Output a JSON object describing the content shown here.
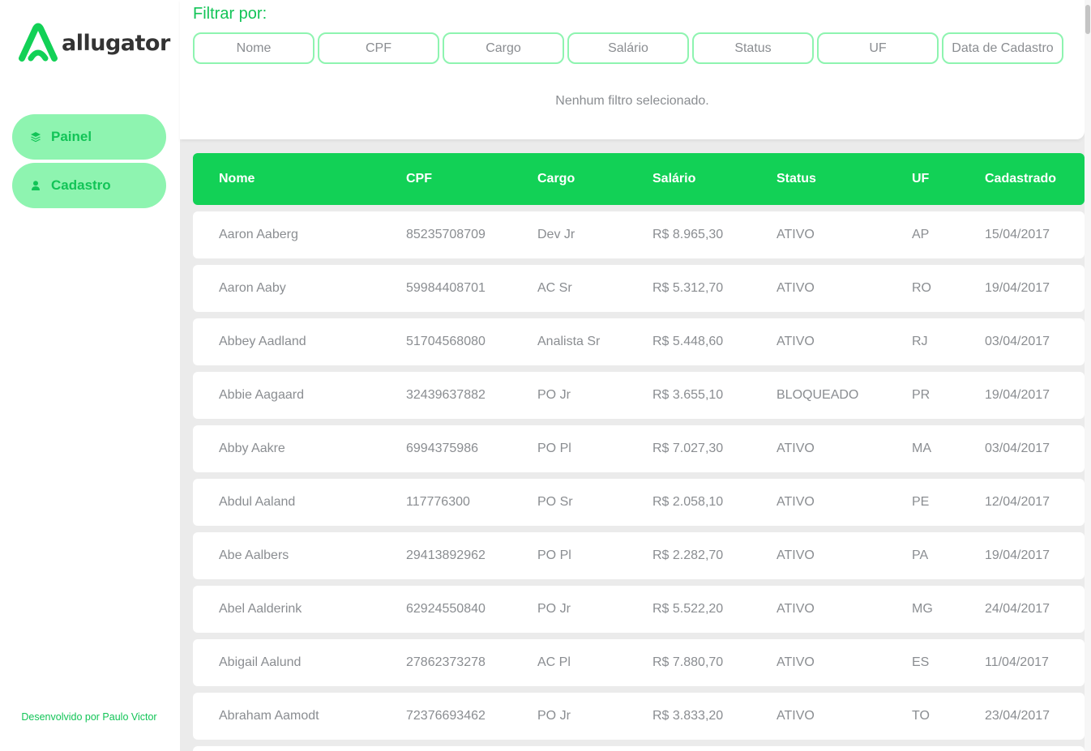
{
  "app": {
    "logo_text": "allugator",
    "brand_color": "#12d156",
    "accent_light": "#8ef4b0",
    "logo_icon": "allugator-a-logo-icon"
  },
  "sidebar": {
    "items": [
      {
        "label": "Painel",
        "icon": "layers-icon"
      },
      {
        "label": "Cadastro",
        "icon": "user-icon"
      }
    ],
    "credit": "Desenvolvido por Paulo Victor"
  },
  "filters": {
    "title": "Filtrar por:",
    "chips": [
      "Nome",
      "CPF",
      "Cargo",
      "Salário",
      "Status",
      "UF",
      "Data de Cadastro"
    ],
    "empty_message": "Nenhum filtro selecionado."
  },
  "table": {
    "columns": [
      "Nome",
      "CPF",
      "Cargo",
      "Salário",
      "Status",
      "UF",
      "Cadastrado"
    ],
    "rows": [
      [
        "Aaron Aaberg",
        "85235708709",
        "Dev Jr",
        "R$ 8.965,30",
        "ATIVO",
        "AP",
        "15/04/2017"
      ],
      [
        "Aaron Aaby",
        "59984408701",
        "AC Sr",
        "R$ 5.312,70",
        "ATIVO",
        "RO",
        "19/04/2017"
      ],
      [
        "Abbey Aadland",
        "51704568080",
        "Analista Sr",
        "R$ 5.448,60",
        "ATIVO",
        "RJ",
        "03/04/2017"
      ],
      [
        "Abbie Aagaard",
        "32439637882",
        "PO Jr",
        "R$ 3.655,10",
        "BLOQUEADO",
        "PR",
        "19/04/2017"
      ],
      [
        "Abby Aakre",
        "6994375986",
        "PO Pl",
        "R$ 7.027,30",
        "ATIVO",
        "MA",
        "03/04/2017"
      ],
      [
        "Abdul Aaland",
        "117776300",
        "PO Sr",
        "R$ 2.058,10",
        "ATIVO",
        "PE",
        "12/04/2017"
      ],
      [
        "Abe Aalbers",
        "29413892962",
        "PO Pl",
        "R$ 2.282,70",
        "ATIVO",
        "PA",
        "19/04/2017"
      ],
      [
        "Abel Aalderink",
        "62924550840",
        "PO Jr",
        "R$ 5.522,20",
        "ATIVO",
        "MG",
        "24/04/2017"
      ],
      [
        "Abigail Aalund",
        "27862373278",
        "AC Pl",
        "R$ 7.880,70",
        "ATIVO",
        "ES",
        "11/04/2017"
      ],
      [
        "Abraham Aamodt",
        "72376693462",
        "PO Jr",
        "R$ 3.833,20",
        "ATIVO",
        "TO",
        "23/04/2017"
      ],
      [
        "",
        "",
        "",
        "",
        "",
        "",
        ""
      ]
    ]
  }
}
